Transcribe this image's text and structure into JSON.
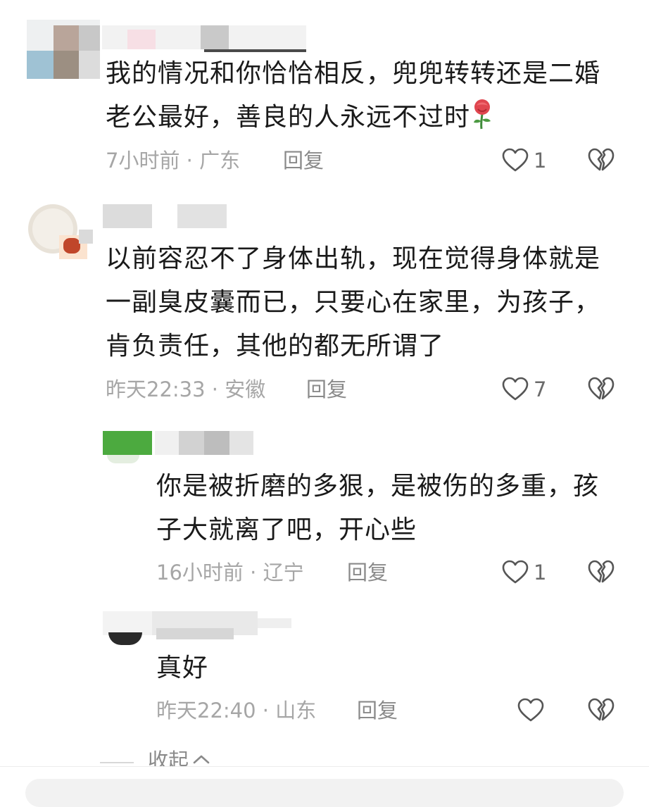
{
  "comments": [
    {
      "text_lines": [
        "我的情况和你恰恰相反，兜兜转转还是二婚",
        "老公最好，善良的人永远不过时"
      ],
      "emoji": "rose",
      "time": "7小时前",
      "location": "广东",
      "reply_label": "回复",
      "likes": "1"
    },
    {
      "text_lines": [
        "以前容忍不了身体出轨，现在觉得身体就是",
        "一副臭皮囊而已，只要心在家里，为孩子，",
        "肯负责任，其他的都无所谓了"
      ],
      "time": "昨天22:33",
      "location": "安徽",
      "reply_label": "回复",
      "likes": "7"
    },
    {
      "text_lines": [
        "你是被折磨的多狠，是被伤的多重，孩",
        "子大就离了吧，开心些"
      ],
      "time": "16小时前",
      "location": "辽宁",
      "reply_label": "回复",
      "likes": "1"
    },
    {
      "text_lines": [
        "真好"
      ],
      "time": "昨天22:40",
      "location": "山东",
      "reply_label": "回复",
      "likes": ""
    }
  ],
  "meta_separator": " · ",
  "collapse_label": "收起",
  "icons": {
    "like": "heart-outline-icon",
    "dislike": "broken-heart-icon",
    "collapse": "chevron-up-icon",
    "emoji": "rose-icon"
  },
  "colors": {
    "text": "#1a1a1a",
    "meta": "#a6a6a6",
    "icon": "#555555"
  }
}
